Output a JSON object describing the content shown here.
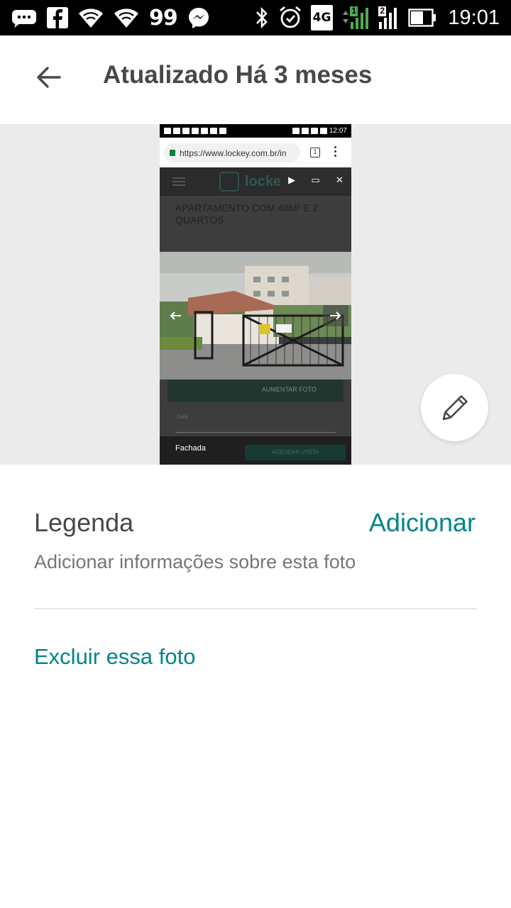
{
  "status_bar": {
    "time": "19:01",
    "notification_count": "99",
    "network": "4G",
    "sim1_label": "1",
    "sim2_label": "2",
    "icons": [
      "messages-icon",
      "facebook-icon",
      "wifi-icon",
      "wifi-icon",
      "messenger-icon",
      "bluetooth-icon",
      "alarm-icon",
      "network-4g-icon",
      "signal-icon",
      "signal-icon",
      "battery-icon"
    ]
  },
  "app_bar": {
    "back_icon": "arrow-left-icon",
    "title": "Atualizado Há 3 meses"
  },
  "photo": {
    "mini_status_time": "12:07",
    "url": "https://www.lockey.com.br/in",
    "tab_count": "1",
    "site_logo": "lockey",
    "listing_title": "APARTAMENTO COM 48M² E 2 QUARTOS",
    "add_photo_label": "AUMENTAR FOTO",
    "select_placeholder": "Sala",
    "caption": "Fachada",
    "bottom_button": "AGENDAR VISITA",
    "edit_icon": "pencil-icon"
  },
  "caption_section": {
    "label": "Legenda",
    "action": "Adicionar",
    "hint": "Adicionar informações sobre esta foto"
  },
  "delete_action": "Excluir essa foto",
  "colors": {
    "accent": "#008489",
    "text": "#484848",
    "hint": "#767676",
    "photo_background": "#ebebeb"
  }
}
